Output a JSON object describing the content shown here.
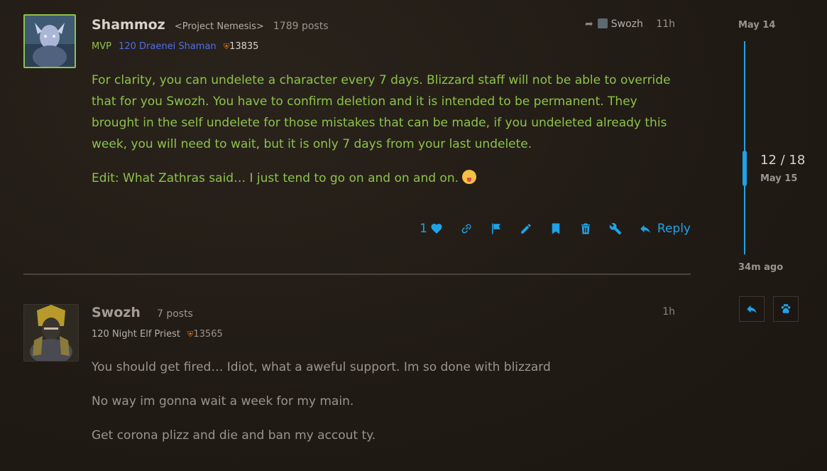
{
  "posts": [
    {
      "username": "Shammoz",
      "user_title": "<Project Nemesis>",
      "post_count": "1789 posts",
      "badge": "MVP",
      "character": "120 Draenei Shaman",
      "item_level": "13835",
      "reply_to_user": "Swozh",
      "time": "11h",
      "paragraphs": [
        "For clarity, you can undelete a character every 7 days. Blizzard staff will not be able to override that for you Swozh. You have to confirm deletion and it is intended to be permanent. They brought in the self undelete for those mistakes that can be made, if you undeleted already this week, you will need to wait, but it is only 7 days from your last undelete.",
        "Edit: What Zathras said… I just tend to go on and on and on."
      ],
      "like_count": "1",
      "reply_label": "Reply"
    },
    {
      "username": "Swozh",
      "post_count": "7 posts",
      "character": "120 Night Elf Priest",
      "item_level": "13565",
      "time": "1h",
      "paragraphs": [
        "You should get fired… Idiot, what a aweful support. Im so done with blizzard",
        "No way im gonna wait a week for my main.",
        "Get corona plizz and die and ban my accout ty."
      ]
    }
  ],
  "timeline": {
    "start_date": "May 14",
    "position": "12 / 18",
    "current_date": "May 15",
    "end_label": "34m ago"
  },
  "colors": {
    "accent": "#1fa3e8",
    "mvp_text": "#8cc34a",
    "class_shaman": "#4d6eea",
    "background": "#221c16"
  }
}
